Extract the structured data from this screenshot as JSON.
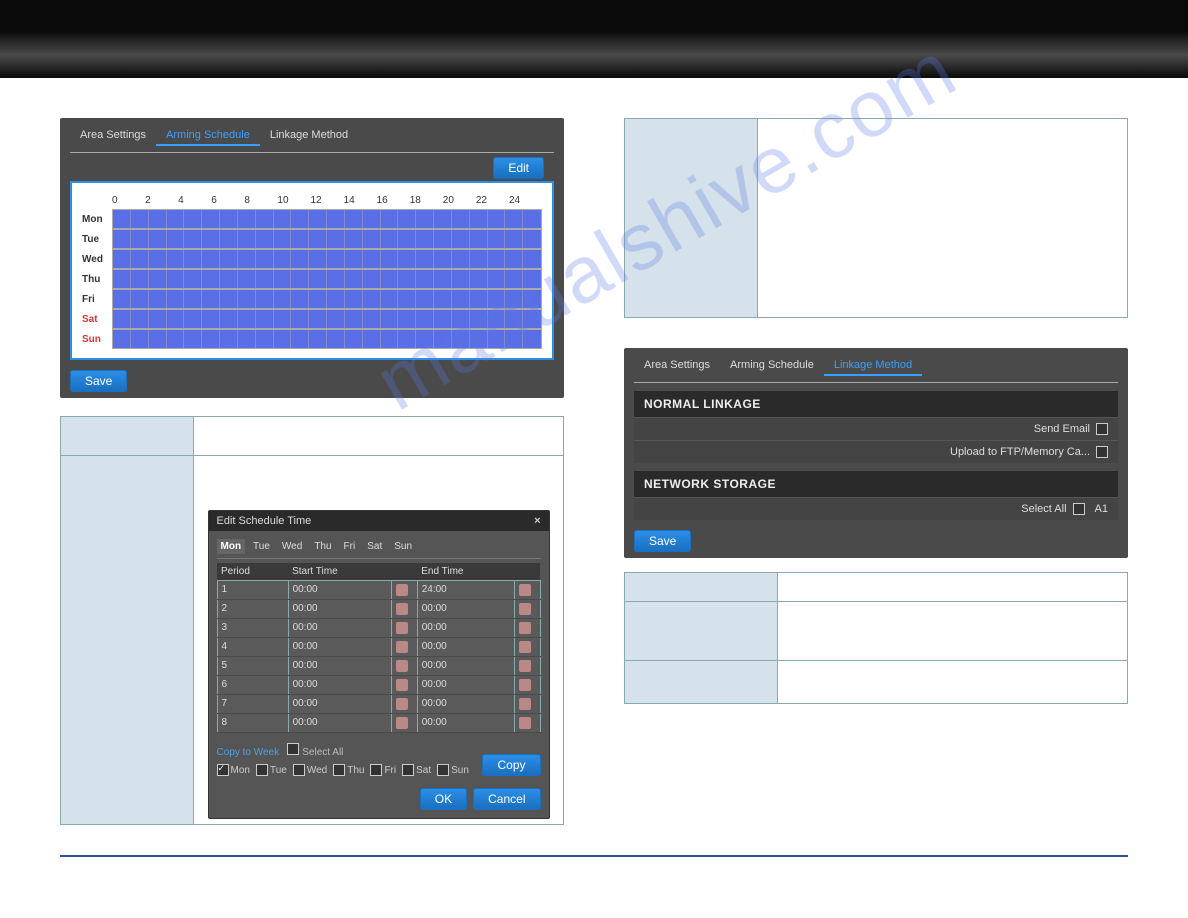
{
  "watermark": "manualshive.com",
  "tabs_arming": {
    "area": "Area Settings",
    "arming": "Arming Schedule",
    "linkage": "Linkage Method"
  },
  "buttons": {
    "edit": "Edit",
    "save": "Save",
    "ok": "OK",
    "cancel": "Cancel",
    "copy": "Copy"
  },
  "schedule": {
    "hours": [
      "0",
      "2",
      "4",
      "6",
      "8",
      "10",
      "12",
      "14",
      "16",
      "18",
      "20",
      "22",
      "24"
    ],
    "days": [
      "Mon",
      "Tue",
      "Wed",
      "Thu",
      "Fri",
      "Sat",
      "Sun"
    ]
  },
  "edit_dialog": {
    "title": "Edit Schedule Time",
    "day_tabs": [
      "Mon",
      "Tue",
      "Wed",
      "Thu",
      "Fri",
      "Sat",
      "Sun"
    ],
    "active_day": "Mon",
    "headers": {
      "period": "Period",
      "start": "Start Time",
      "end": "End Time"
    },
    "rows": [
      {
        "period": "1",
        "start": "00:00",
        "end": "24:00"
      },
      {
        "period": "2",
        "start": "00:00",
        "end": "00:00"
      },
      {
        "period": "3",
        "start": "00:00",
        "end": "00:00"
      },
      {
        "period": "4",
        "start": "00:00",
        "end": "00:00"
      },
      {
        "period": "5",
        "start": "00:00",
        "end": "00:00"
      },
      {
        "period": "6",
        "start": "00:00",
        "end": "00:00"
      },
      {
        "period": "7",
        "start": "00:00",
        "end": "00:00"
      },
      {
        "period": "8",
        "start": "00:00",
        "end": "00:00"
      }
    ],
    "copy_to_week": "Copy to Week",
    "select_all": "Select All",
    "days_copy": [
      {
        "label": "Mon",
        "checked": true
      },
      {
        "label": "Tue",
        "checked": false
      },
      {
        "label": "Wed",
        "checked": false
      },
      {
        "label": "Thu",
        "checked": false
      },
      {
        "label": "Fri",
        "checked": false
      },
      {
        "label": "Sat",
        "checked": false
      },
      {
        "label": "Sun",
        "checked": false
      }
    ]
  },
  "linkage": {
    "normal": "NORMAL LINKAGE",
    "send_email": "Send Email",
    "upload": "Upload to FTP/Memory Ca...",
    "net_storage": "NETWORK STORAGE",
    "select_all": "Select All",
    "a1": "A1"
  }
}
